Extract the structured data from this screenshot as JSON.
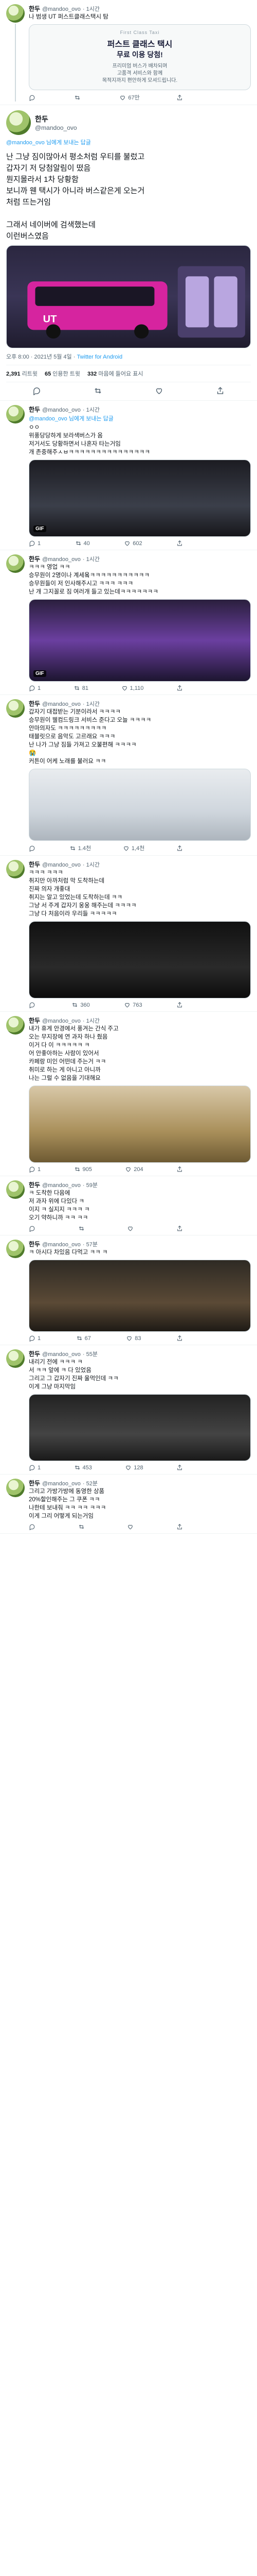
{
  "colors": {
    "accent": "#1d9bf0",
    "muted": "#536471",
    "text": "#0f1419",
    "bus_pink": "#d6249f"
  },
  "tweets": [
    {
      "name": "한두",
      "handle": "@mandoo_ovo",
      "time": "· 1시간",
      "text": "나 범생 UT 퍼스트클래스택시 탐",
      "card": {
        "sub": "First Class Taxi",
        "title": "퍼스트 클래스 택시",
        "title2": "무료 이용 당첨!",
        "desc": "프리미엄 버스가 배차되며\n고품격 서비스와 함께\n목적지까지 편안하게 모셔드립니다."
      },
      "replies": "",
      "retweets": "",
      "likes": "67만",
      "views": "6,998"
    }
  ],
  "main": {
    "reply_to": "@mandoo_ovo 님에게 보내는 답글",
    "name": "한두",
    "handle": "@mandoo_ovo",
    "text": "난 그냥 짐이많아서 평소처럼 우티를 불렀고\n갑자기 저 당첨알림이 떴음\n뭔지몰라서 1차 당황함\n보니까 웬 택시가 아니라 버스같은게 오는거\n처럼 뜨는거임\n\n그래서 네이버에 검색했는데\n이런버스였음",
    "meta_time": "오후 8:00 · 2021년 5월 4일 · ",
    "meta_client": "Twitter for Android",
    "retweets_num": "2,391",
    "retweets_label": "리트윗",
    "quotes_num": "65",
    "quotes_label": "인용한 트윗",
    "likes_num": "332",
    "likes_label": "마음에 들어요 표시"
  },
  "replies": [
    {
      "name": "한두",
      "handle": "@mandoo_ovo",
      "time": "· 1시간",
      "reply_to": "@mandoo_ovo 님에게 보내는 답글",
      "text": "ㅇㅇ\n위풍당당하게 보라색버스가 옴\n저거서도 당황하면서 나혼자 타는거임\n개 존중해주ㅅㅂㅋㅋㅋㅋㅋㅋㅋㅋㅋㅋㅋㅋㅋㅋㅋ",
      "gif": true,
      "replies": "1",
      "retweets": "40",
      "likes": "602"
    },
    {
      "name": "한두",
      "handle": "@mandoo_ovo",
      "time": "· 1시간",
      "text": "ㅋㅋㅋ 영업 ㅋㅋ\n승무원이 2명이나 계세욬ㅋㅋㅋㅋㅋㅋㅋㅋㅋㅋㅋ\n승무원들이 저 인사해주시고 ㅋㅋㅋ ㅋㅋㅋ\n난 개 그지꼴로 짐 여러개 들고 있는데ㅋㅋㅋㅋㅋㅋㅋ",
      "gif": true,
      "replies": "1",
      "retweets": "81",
      "likes": "1,110"
    },
    {
      "name": "한두",
      "handle": "@mandoo_ovo",
      "time": "· 1시간",
      "text": "갑자기 대접받는 기분이라서 ㅋㅋㅋㅋ\n승무원이 웰컴드링크 서비스 준다고 오늘 ㅋㅋㅋㅋ\n안마의자도 ㅋㅋㅋㅋㅋㅋㅋㅋㅋ\n태블릿으로 음악도 고르래요 ㅋㅋㅋ\n난 나가 그냥 짐들 가져고 오불편해 ㅋㅋㅋㅋ\n😭\n커튼이 어케 노래를 불러요 ㅋㅋ",
      "gif": false,
      "replies": "",
      "retweets": "1.4천",
      "likes": "1,4천"
    },
    {
      "name": "한두",
      "handle": "@mandoo_ovo",
      "time": "· 1시간",
      "text": "ㅋㅋㅋ ㅋㅋㅋ\n취지만 아까처럼 막 도착하는데\n진짜 의자 개좋대\n취지는 알고 있었는데 도착하는데 ㅋㅋ\n그냥 서 주게 갑자기 웅웅 해주는데 ㅋㅋㅋㅋ\n그냥 다 처음이라 우리들 ㅋㅋㅋㅋㅋ",
      "gif": false,
      "replies": "",
      "retweets": "360",
      "likes": "763"
    },
    {
      "name": "한두",
      "handle": "@mandoo_ovo",
      "time": "· 1시간",
      "text": "내가 휴게 안경에서 풍겨는 간식 주고\n오는 무지장에 연 과자 하나 줬음\n이거 다 이 ㅋㅋㅋㅋㅋ ㅋ\n어 안좋아하는 사람이 있어서\n카페랑 미인 어떤데 주는거 ㅋㅋ\n취미로 하는 게 아니고 아니까\n나는 그럴 수 없음을 기대해요",
      "gif": false,
      "replies": "1",
      "retweets": "905",
      "likes": "204"
    },
    {
      "name": "한두",
      "handle": "@mandoo_ovo",
      "time": "· 59분",
      "text": "ㅋ 도착한 다음에\n저 과자 위에 다있다 ㅋ\n이지 ㅋ 실지지 ㅋㅋㅋ ㅋ\n오기 약하니까 ㅋㅋ ㅋㅋ",
      "gif": false,
      "replies": "",
      "retweets": "",
      "likes": ""
    },
    {
      "name": "한두",
      "handle": "@mandoo_ovo",
      "time": "· 57분",
      "text": "ㅋ 아시다 차있음 다먹고 ㅋㅋ ㅋ",
      "gif": false,
      "replies": "1",
      "retweets": "67",
      "likes": "83"
    },
    {
      "name": "한두",
      "handle": "@mandoo_ovo",
      "time": "· 55분",
      "text": "내리기 전에 ㅋㅋㅋ ㅋ\n서 ㅋㅋ 앞에 ㅋ 다 있었음\n그리고 그 갑자기 진짜 울먹인데 ㅋㅋ\n이게 그냥 마지막임",
      "gif": false,
      "replies": "1",
      "retweets": "453",
      "likes": "128"
    },
    {
      "name": "한두",
      "handle": "@mandoo_ovo",
      "time": "· 52분",
      "text": "그리고 가방가방에 동영한 상품\n20%할인해주는 그 쿠폰 ㅋㅋ\n나한테 보내줘 ㅋㅋ ㅋㅋ ㅋㅋㅋ\n이게 그리 어떻게 되는거임",
      "gif": false,
      "replies": "",
      "retweets": "",
      "likes": ""
    }
  ]
}
